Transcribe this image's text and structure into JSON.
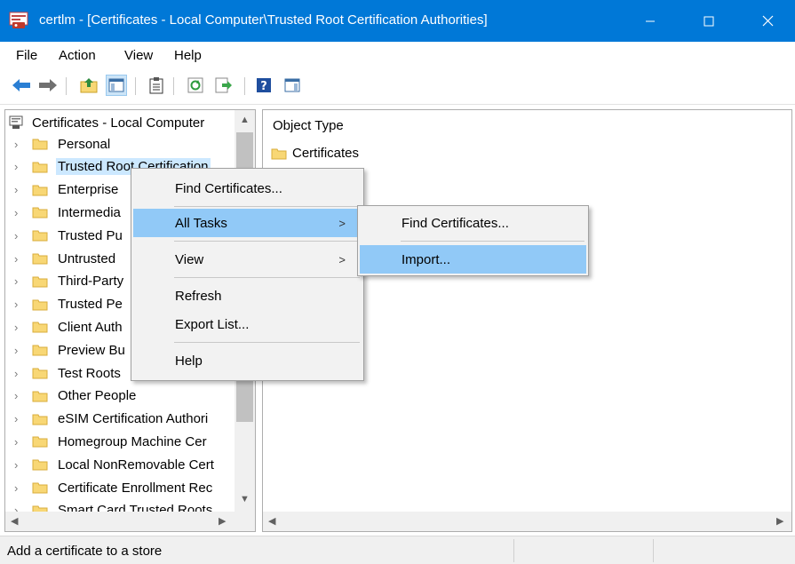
{
  "window": {
    "title": "certlm - [Certificates - Local Computer\\Trusted Root Certification Authorities]",
    "controls": {
      "minimize": "—",
      "maximize": "☐",
      "close": "✕"
    }
  },
  "menu": [
    "File",
    "Action",
    "View",
    "Help"
  ],
  "toolbar": {
    "icons": [
      "back-arrow",
      "forward-arrow",
      "up-folder",
      "show-hide-console-tree",
      "properties",
      "refresh",
      "export-list",
      "help",
      "action-pane"
    ]
  },
  "tree": {
    "root": "Certificates - Local Computer",
    "items": [
      {
        "label": "Personal",
        "selected": false
      },
      {
        "label": "Trusted Root Certification",
        "selected": true
      },
      {
        "label": "Enterprise",
        "selected": false
      },
      {
        "label": "Intermedia",
        "selected": false
      },
      {
        "label": "Trusted Pu",
        "selected": false
      },
      {
        "label": "Untrusted",
        "selected": false
      },
      {
        "label": "Third-Party",
        "selected": false
      },
      {
        "label": "Trusted Pe",
        "selected": false
      },
      {
        "label": "Client Auth",
        "selected": false
      },
      {
        "label": "Preview Bu",
        "selected": false
      },
      {
        "label": "Test Roots",
        "selected": false
      },
      {
        "label": "Other People",
        "selected": false
      },
      {
        "label": "eSIM Certification Authori",
        "selected": false
      },
      {
        "label": "Homegroup Machine Cer",
        "selected": false
      },
      {
        "label": "Local NonRemovable Cert",
        "selected": false
      },
      {
        "label": "Certificate Enrollment Rec",
        "selected": false
      },
      {
        "label": "Smart Card Trusted Roots",
        "selected": false
      }
    ]
  },
  "details": {
    "column_header": "Object Type",
    "items": [
      "Certificates"
    ]
  },
  "context_menu": {
    "find": "Find Certificates...",
    "all_tasks": "All Tasks",
    "view": "View",
    "refresh": "Refresh",
    "export": "Export List...",
    "help": "Help"
  },
  "submenu": {
    "find": "Find Certificates...",
    "import": "Import..."
  },
  "status": {
    "text": "Add a certificate to a store"
  },
  "colors": {
    "titlebar": "#0078d7",
    "highlight": "#91c9f7",
    "selection": "#cce8ff",
    "folder": "#f8d775"
  }
}
